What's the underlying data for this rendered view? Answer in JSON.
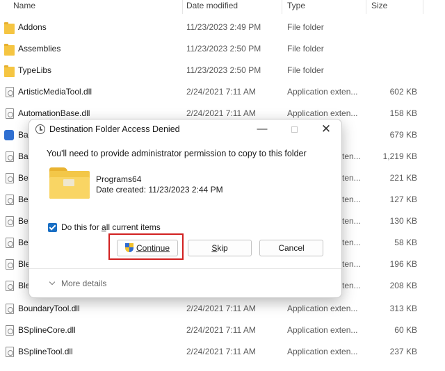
{
  "columns": {
    "name": "Name",
    "date_modified": "Date modified",
    "type": "Type",
    "size": "Size"
  },
  "files": [
    {
      "icon": "folder-icon",
      "name": "Addons",
      "date": "11/23/2023 2:49 PM",
      "type": "File folder",
      "size": ""
    },
    {
      "icon": "folder-icon",
      "name": "Assemblies",
      "date": "11/23/2023 2:50 PM",
      "type": "File folder",
      "size": ""
    },
    {
      "icon": "folder-icon",
      "name": "TypeLibs",
      "date": "11/23/2023 2:50 PM",
      "type": "File folder",
      "size": ""
    },
    {
      "icon": "dll-file-icon",
      "name": "ArtisticMediaTool.dll",
      "date": "2/24/2021 7:11 AM",
      "type": "Application exten...",
      "size": "602 KB"
    },
    {
      "icon": "dll-file-icon",
      "name": "AutomationBase.dll",
      "date": "2/24/2021 7:11 AM",
      "type": "Application exten...",
      "size": "158 KB"
    },
    {
      "icon": "app-icon",
      "name": "Ba",
      "date": "",
      "type": "",
      "size": "679 KB"
    },
    {
      "icon": "dll-file-icon",
      "name": "Ba",
      "date": "",
      "type": "ten...",
      "size": "1,219 KB"
    },
    {
      "icon": "dll-file-icon",
      "name": "Be",
      "date": "",
      "type": "ten...",
      "size": "221 KB"
    },
    {
      "icon": "dll-file-icon",
      "name": "Be",
      "date": "",
      "type": "ten...",
      "size": "127 KB"
    },
    {
      "icon": "dll-file-icon",
      "name": "Be",
      "date": "",
      "type": "ten...",
      "size": "130 KB"
    },
    {
      "icon": "dll-file-icon",
      "name": "Be",
      "date": "",
      "type": "ten...",
      "size": "58 KB"
    },
    {
      "icon": "dll-file-icon",
      "name": "Ble",
      "date": "",
      "type": "ten...",
      "size": "196 KB"
    },
    {
      "icon": "dll-file-icon",
      "name": "Ble",
      "date": "",
      "type": "ten...",
      "size": "208 KB"
    },
    {
      "icon": "dll-file-icon",
      "name": "BoundaryTool.dll",
      "date": "2/24/2021 7:11 AM",
      "type": "Application exten...",
      "size": "313 KB"
    },
    {
      "icon": "dll-file-icon",
      "name": "BSplineCore.dll",
      "date": "2/24/2021 7:11 AM",
      "type": "Application exten...",
      "size": "60 KB"
    },
    {
      "icon": "dll-file-icon",
      "name": "BSplineTool.dll",
      "date": "2/24/2021 7:11 AM",
      "type": "Application exten...",
      "size": "237 KB"
    }
  ],
  "dialog": {
    "title": "Destination Folder Access Denied",
    "minimize_glyph": "—",
    "close_glyph": "✕",
    "message": "You'll need to provide administrator permission to copy to this folder",
    "folder_name": "Programs64",
    "folder_date": "Date created: 11/23/2023 2:44 PM",
    "checkbox_prefix": "Do this for ",
    "checkbox_underlined": "a",
    "checkbox_suffix": "ll current items",
    "checkbox_checked": true,
    "continue_underlined": "C",
    "continue_rest": "ontinue",
    "skip_underlined": "S",
    "skip_rest": "kip",
    "cancel_label": "Cancel",
    "more_details": "More details",
    "highlight_color": "#d12020",
    "accent_color": "#1a6fc4"
  }
}
